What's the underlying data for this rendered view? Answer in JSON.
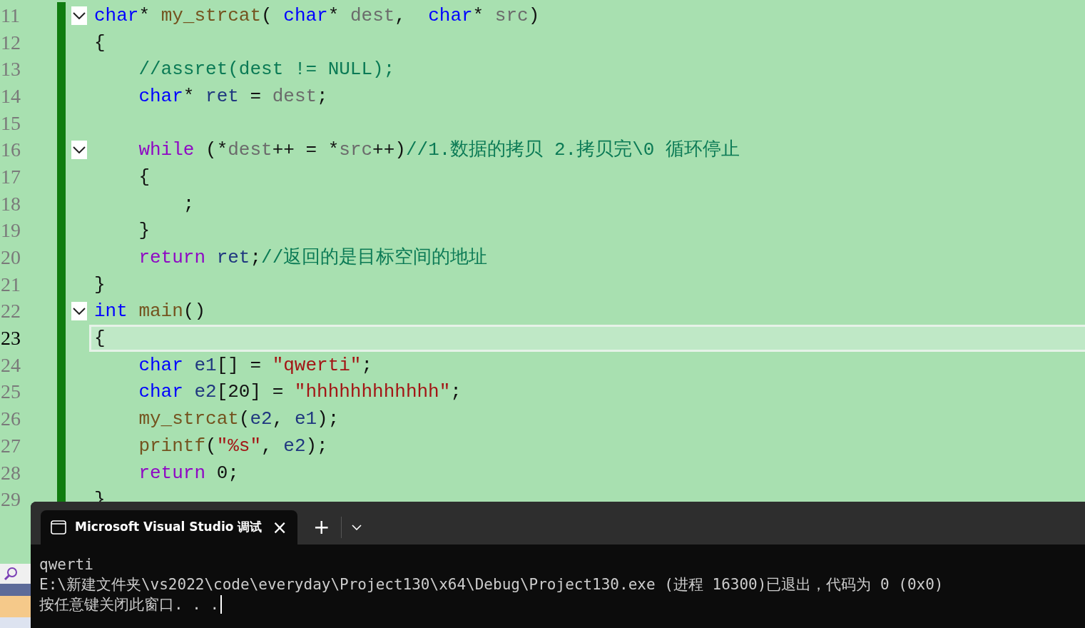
{
  "editor": {
    "lines": [
      {
        "number": "11",
        "foldable": true,
        "expanded": true,
        "current": false,
        "tokens": [
          {
            "kind": "keyword",
            "text": "char"
          },
          {
            "kind": "plain",
            "text": "* "
          },
          {
            "kind": "function",
            "text": "my_strcat"
          },
          {
            "kind": "plain",
            "text": "( "
          },
          {
            "kind": "keyword",
            "text": "char"
          },
          {
            "kind": "plain",
            "text": "* "
          },
          {
            "kind": "param",
            "text": "dest"
          },
          {
            "kind": "plain",
            "text": ",  "
          },
          {
            "kind": "keyword",
            "text": "char"
          },
          {
            "kind": "plain",
            "text": "* "
          },
          {
            "kind": "param",
            "text": "src"
          },
          {
            "kind": "plain",
            "text": ")"
          }
        ]
      },
      {
        "number": "12",
        "foldable": false,
        "current": false,
        "tokens": [
          {
            "kind": "plain",
            "text": "{"
          }
        ]
      },
      {
        "number": "13",
        "foldable": false,
        "current": false,
        "tokens": [
          {
            "kind": "comment",
            "text": "    //assret(dest != NULL);"
          }
        ]
      },
      {
        "number": "14",
        "foldable": false,
        "current": false,
        "tokens": [
          {
            "kind": "keyword",
            "text": "    char"
          },
          {
            "kind": "plain",
            "text": "* "
          },
          {
            "kind": "local",
            "text": "ret"
          },
          {
            "kind": "plain",
            "text": " = "
          },
          {
            "kind": "param",
            "text": "dest"
          },
          {
            "kind": "plain",
            "text": ";"
          }
        ]
      },
      {
        "number": "15",
        "foldable": false,
        "current": false
      },
      {
        "number": "16",
        "foldable": true,
        "expanded": true,
        "current": false,
        "tokens": [
          {
            "kind": "control",
            "text": "    while"
          },
          {
            "kind": "plain",
            "text": " (*"
          },
          {
            "kind": "param",
            "text": "dest"
          },
          {
            "kind": "plain",
            "text": "++ = *"
          },
          {
            "kind": "param",
            "text": "src"
          },
          {
            "kind": "plain",
            "text": "++)"
          },
          {
            "kind": "comment",
            "text": "//1.数据的拷贝 2.拷贝完\\0 循环停止"
          }
        ]
      },
      {
        "number": "17",
        "foldable": false,
        "current": false,
        "tokens": [
          {
            "kind": "plain",
            "text": "    {"
          }
        ]
      },
      {
        "number": "18",
        "foldable": false,
        "current": false,
        "tokens": [
          {
            "kind": "plain",
            "text": "        ;"
          }
        ]
      },
      {
        "number": "19",
        "foldable": false,
        "current": false,
        "tokens": [
          {
            "kind": "plain",
            "text": "    }"
          }
        ]
      },
      {
        "number": "20",
        "foldable": false,
        "current": false,
        "tokens": [
          {
            "kind": "control",
            "text": "    return"
          },
          {
            "kind": "local",
            "text": " ret"
          },
          {
            "kind": "plain",
            "text": ";"
          },
          {
            "kind": "comment",
            "text": "//返回的是目标空间的地址"
          }
        ]
      },
      {
        "number": "21",
        "foldable": false,
        "current": false,
        "tokens": [
          {
            "kind": "plain",
            "text": "}"
          }
        ]
      },
      {
        "number": "22",
        "foldable": true,
        "expanded": true,
        "current": false,
        "tokens": [
          {
            "kind": "keyword",
            "text": "int"
          },
          {
            "kind": "function",
            "text": " main"
          },
          {
            "kind": "plain",
            "text": "()"
          }
        ]
      },
      {
        "number": "23",
        "foldable": false,
        "current": true,
        "tokens": [
          {
            "kind": "plain",
            "text": "{"
          }
        ]
      },
      {
        "number": "24",
        "foldable": false,
        "current": false,
        "tokens": [
          {
            "kind": "keyword",
            "text": "    char"
          },
          {
            "kind": "local",
            "text": " e1"
          },
          {
            "kind": "plain",
            "text": "[] = "
          },
          {
            "kind": "string",
            "text": "\"qwerti\""
          },
          {
            "kind": "plain",
            "text": ";"
          }
        ]
      },
      {
        "number": "25",
        "foldable": false,
        "current": false,
        "tokens": [
          {
            "kind": "keyword",
            "text": "    char"
          },
          {
            "kind": "local",
            "text": " e2"
          },
          {
            "kind": "plain",
            "text": "[20] = "
          },
          {
            "kind": "string",
            "text": "\"hhhhhhhhhhhh\""
          },
          {
            "kind": "plain",
            "text": ";"
          }
        ]
      },
      {
        "number": "26",
        "foldable": false,
        "current": false,
        "tokens": [
          {
            "kind": "function",
            "text": "    my_strcat"
          },
          {
            "kind": "plain",
            "text": "("
          },
          {
            "kind": "local",
            "text": "e2"
          },
          {
            "kind": "plain",
            "text": ", "
          },
          {
            "kind": "local",
            "text": "e1"
          },
          {
            "kind": "plain",
            "text": ");"
          }
        ]
      },
      {
        "number": "27",
        "foldable": false,
        "current": false,
        "tokens": [
          {
            "kind": "function",
            "text": "    printf"
          },
          {
            "kind": "plain",
            "text": "("
          },
          {
            "kind": "string",
            "text": "\"%s\""
          },
          {
            "kind": "plain",
            "text": ", "
          },
          {
            "kind": "local",
            "text": "e2"
          },
          {
            "kind": "plain",
            "text": ");"
          }
        ]
      },
      {
        "number": "28",
        "foldable": false,
        "current": false,
        "tokens": [
          {
            "kind": "control",
            "text": "    return"
          },
          {
            "kind": "plain",
            "text": " 0;"
          }
        ]
      },
      {
        "number": "29",
        "foldable": false,
        "current": false,
        "tokens": [
          {
            "kind": "plain",
            "text": "}"
          }
        ]
      }
    ]
  },
  "terminal": {
    "tab_title": "Microsoft Visual Studio 调试",
    "close": "×",
    "new_tab": "+",
    "output": [
      "qwerti",
      "E:\\新建文件夹\\vs2022\\code\\everyday\\Project130\\x64\\Debug\\Project130.exe (进程 16300)已退出，代码为 0 (0x0)",
      "按任意键关闭此窗口. . ."
    ]
  }
}
